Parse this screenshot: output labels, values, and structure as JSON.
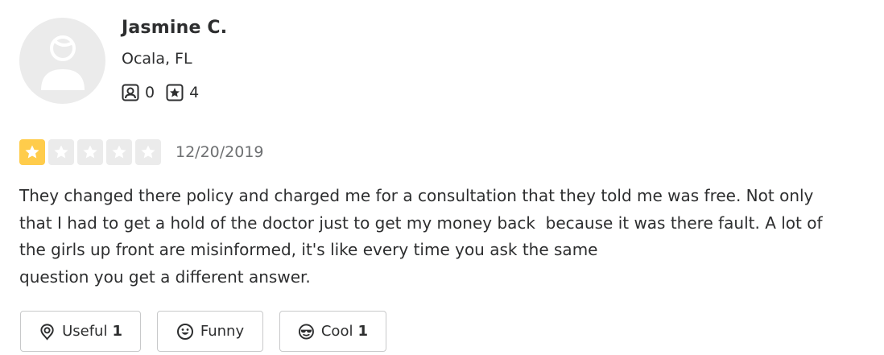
{
  "user": {
    "name": "Jasmine C.",
    "location": "Ocala, FL",
    "friends_count": "0",
    "reviews_count": "4"
  },
  "rating": {
    "value": 1,
    "max": 5,
    "date": "12/20/2019",
    "filled_color": "#ffcc4b",
    "empty_color": "#ebebeb"
  },
  "review": {
    "text": "They changed there policy and charged me for a consultation that they told me was free. Not only\nthat I had to get a hold of the doctor just to get my money back  because it was there fault. A lot of\nthe girls up front are misinformed, it's like every time you ask the same\nquestion you get a different answer."
  },
  "reactions": {
    "useful_label": "Useful",
    "useful_count": "1",
    "funny_label": "Funny",
    "cool_label": "Cool",
    "cool_count": "1"
  },
  "icons": {
    "avatar": "user-silhouette-icon",
    "friends": "friends-icon",
    "reviews": "review-star-icon",
    "useful": "lightbulb-icon",
    "funny": "smile-icon",
    "cool": "sunglasses-icon"
  }
}
